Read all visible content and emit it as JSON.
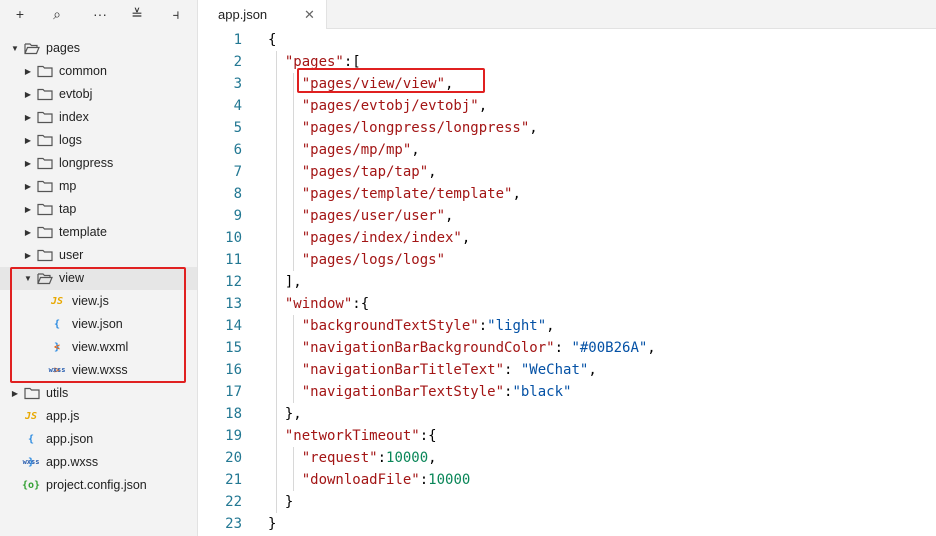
{
  "toolbar": {
    "buttons": [
      {
        "name": "add-icon",
        "glyph": "+"
      },
      {
        "name": "search-icon",
        "glyph": "⌕"
      },
      {
        "name": "more-icon",
        "glyph": "···"
      },
      {
        "name": "collapse-all-icon",
        "glyph": "≚"
      },
      {
        "name": "toggle-sidebar-icon",
        "glyph": "⫞"
      }
    ]
  },
  "tree": [
    {
      "label": "pages",
      "indent": 0,
      "type": "folder",
      "open": true
    },
    {
      "label": "common",
      "indent": 1,
      "type": "folder",
      "open": false
    },
    {
      "label": "evtobj",
      "indent": 1,
      "type": "folder",
      "open": false
    },
    {
      "label": "index",
      "indent": 1,
      "type": "folder",
      "open": false
    },
    {
      "label": "logs",
      "indent": 1,
      "type": "folder",
      "open": false
    },
    {
      "label": "longpress",
      "indent": 1,
      "type": "folder",
      "open": false
    },
    {
      "label": "mp",
      "indent": 1,
      "type": "folder",
      "open": false
    },
    {
      "label": "tap",
      "indent": 1,
      "type": "folder",
      "open": false
    },
    {
      "label": "template",
      "indent": 1,
      "type": "folder",
      "open": false
    },
    {
      "label": "user",
      "indent": 1,
      "type": "folder",
      "open": false
    },
    {
      "label": "view",
      "indent": 1,
      "type": "folder",
      "open": true,
      "selected": true
    },
    {
      "label": "view.js",
      "indent": 2,
      "type": "js",
      "badge": "JS"
    },
    {
      "label": "view.json",
      "indent": 2,
      "type": "json",
      "badge": "{ }"
    },
    {
      "label": "view.wxml",
      "indent": 2,
      "type": "wxml",
      "badge": "< >"
    },
    {
      "label": "view.wxss",
      "indent": 2,
      "type": "wxss",
      "badge": "wxss"
    },
    {
      "label": "utils",
      "indent": 0,
      "type": "folder",
      "open": false
    },
    {
      "label": "app.js",
      "indent": 0,
      "type": "js",
      "badge": "JS"
    },
    {
      "label": "app.json",
      "indent": 0,
      "type": "json",
      "badge": "{ }"
    },
    {
      "label": "app.wxss",
      "indent": 0,
      "type": "wxss",
      "badge": "wxss"
    },
    {
      "label": "project.config.json",
      "indent": 0,
      "type": "cfg",
      "badge": "{o}"
    }
  ],
  "tab": {
    "label": "app.json",
    "close": "✕"
  },
  "code_lines": [
    [
      {
        "t": "{",
        "c": "p"
      }
    ],
    [
      {
        "t": "  \"pages\"",
        "c": "s"
      },
      {
        "t": ":[",
        "c": "p"
      }
    ],
    [
      {
        "t": "    \"pages/view/view\"",
        "c": "s"
      },
      {
        "t": ",",
        "c": "p"
      }
    ],
    [
      {
        "t": "    \"pages/evtobj/evtobj\"",
        "c": "s"
      },
      {
        "t": ",",
        "c": "p"
      }
    ],
    [
      {
        "t": "    \"pages/longpress/longpress\"",
        "c": "s"
      },
      {
        "t": ",",
        "c": "p"
      }
    ],
    [
      {
        "t": "    \"pages/mp/mp\"",
        "c": "s"
      },
      {
        "t": ",",
        "c": "p"
      }
    ],
    [
      {
        "t": "    \"pages/tap/tap\"",
        "c": "s"
      },
      {
        "t": ",",
        "c": "p"
      }
    ],
    [
      {
        "t": "    \"pages/template/template\"",
        "c": "s"
      },
      {
        "t": ",",
        "c": "p"
      }
    ],
    [
      {
        "t": "    \"pages/user/user\"",
        "c": "s"
      },
      {
        "t": ",",
        "c": "p"
      }
    ],
    [
      {
        "t": "    \"pages/index/index\"",
        "c": "s"
      },
      {
        "t": ",",
        "c": "p"
      }
    ],
    [
      {
        "t": "    \"pages/logs/logs\"",
        "c": "s"
      }
    ],
    [
      {
        "t": "  ],",
        "c": "p"
      }
    ],
    [
      {
        "t": "  \"window\"",
        "c": "s"
      },
      {
        "t": ":{",
        "c": "p"
      }
    ],
    [
      {
        "t": "    \"backgroundTextStyle\"",
        "c": "s"
      },
      {
        "t": ":",
        "c": "p"
      },
      {
        "t": "\"light\"",
        "c": "v"
      },
      {
        "t": ",",
        "c": "p"
      }
    ],
    [
      {
        "t": "    \"navigationBarBackgroundColor\"",
        "c": "s"
      },
      {
        "t": ": ",
        "c": "p"
      },
      {
        "t": "\"#00B26A\"",
        "c": "v"
      },
      {
        "t": ",",
        "c": "p"
      }
    ],
    [
      {
        "t": "    \"navigationBarTitleText\"",
        "c": "s"
      },
      {
        "t": ": ",
        "c": "p"
      },
      {
        "t": "\"WeChat\"",
        "c": "v"
      },
      {
        "t": ",",
        "c": "p"
      }
    ],
    [
      {
        "t": "    \"navigationBarTextStyle\"",
        "c": "s"
      },
      {
        "t": ":",
        "c": "p"
      },
      {
        "t": "\"black\"",
        "c": "v"
      }
    ],
    [
      {
        "t": "  },",
        "c": "p"
      }
    ],
    [
      {
        "t": "  \"networkTimeout\"",
        "c": "s"
      },
      {
        "t": ":{",
        "c": "p"
      }
    ],
    [
      {
        "t": "    \"request\"",
        "c": "s"
      },
      {
        "t": ":",
        "c": "p"
      },
      {
        "t": "10000",
        "c": "n"
      },
      {
        "t": ",",
        "c": "p"
      }
    ],
    [
      {
        "t": "    \"downloadFile\"",
        "c": "s"
      },
      {
        "t": ":",
        "c": "p"
      },
      {
        "t": "10000",
        "c": "n"
      }
    ],
    [
      {
        "t": "  }",
        "c": "p"
      }
    ],
    [
      {
        "t": "}",
        "c": "p"
      }
    ]
  ],
  "colors": {
    "folder": "#555555",
    "selected_row": "#e6e6e6",
    "highlight": "#e02020",
    "line_number": "#237893",
    "string": "#a31515",
    "value": "#0451a5",
    "number": "#098658"
  }
}
